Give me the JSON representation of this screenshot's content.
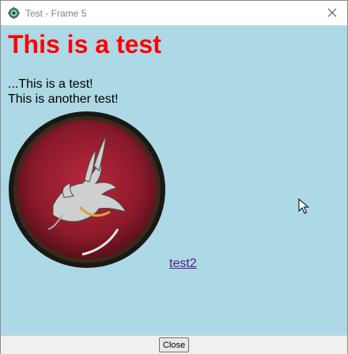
{
  "window": {
    "title": "Test - Frame 5"
  },
  "content": {
    "heading": "This is a test",
    "line1": "...This is a test!",
    "line2": "This is another test!",
    "link": "test2",
    "image_icon": "dragon-emblem-image"
  },
  "footer": {
    "close_label": "Close"
  },
  "colors": {
    "background": "#add8e6",
    "heading": "#ff0000",
    "link": "#551a8b"
  },
  "icons": {
    "app": "app-gear-icon",
    "window_close": "close-icon",
    "pointer": "mouse-cursor-icon"
  }
}
